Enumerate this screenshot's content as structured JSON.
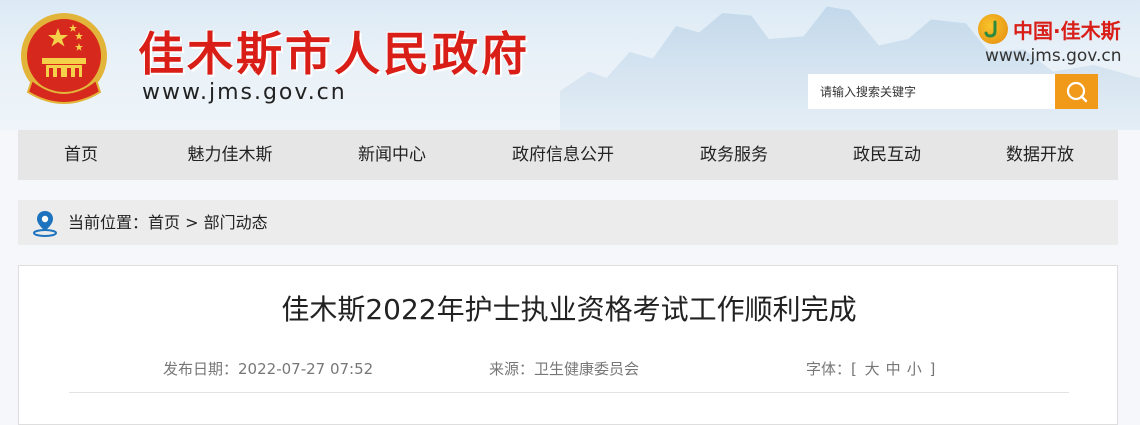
{
  "header": {
    "site_title": "佳木斯市人民政府",
    "site_domain": "www.jms.gov.cn",
    "brand_text": "中国·佳木斯",
    "brand_domain": "www.jms.gov.cn",
    "search_placeholder": "请输入搜索关键字"
  },
  "nav": {
    "items": [
      {
        "label": "首页"
      },
      {
        "label": "魅力佳木斯"
      },
      {
        "label": "新闻中心"
      },
      {
        "label": "政府信息公开"
      },
      {
        "label": "政务服务"
      },
      {
        "label": "政民互动"
      },
      {
        "label": "数据开放"
      }
    ]
  },
  "breadcrumb": {
    "prefix": "当前位置：",
    "home": "首页",
    "separator": " > ",
    "current": "部门动态"
  },
  "article": {
    "title": "佳木斯2022年护士执业资格考试工作顺利完成",
    "date_label": "发布日期：",
    "date_value": "2022-07-27 07:52",
    "source_label": "来源：",
    "source_value": "卫生健康委员会",
    "font_label": "字体：",
    "font_open": "[",
    "font_large": "大",
    "font_medium": "中",
    "font_small": "小",
    "font_close": "]"
  },
  "colors": {
    "title_red": "#d91e18",
    "search_orange": "#f19a19",
    "nav_bg": "#e6e6e6",
    "pin_blue": "#1e73be"
  },
  "icons": {
    "emblem": "national-emblem-icon",
    "brand": "brand-logo-icon",
    "search": "search-icon",
    "location": "location-pin-icon"
  }
}
